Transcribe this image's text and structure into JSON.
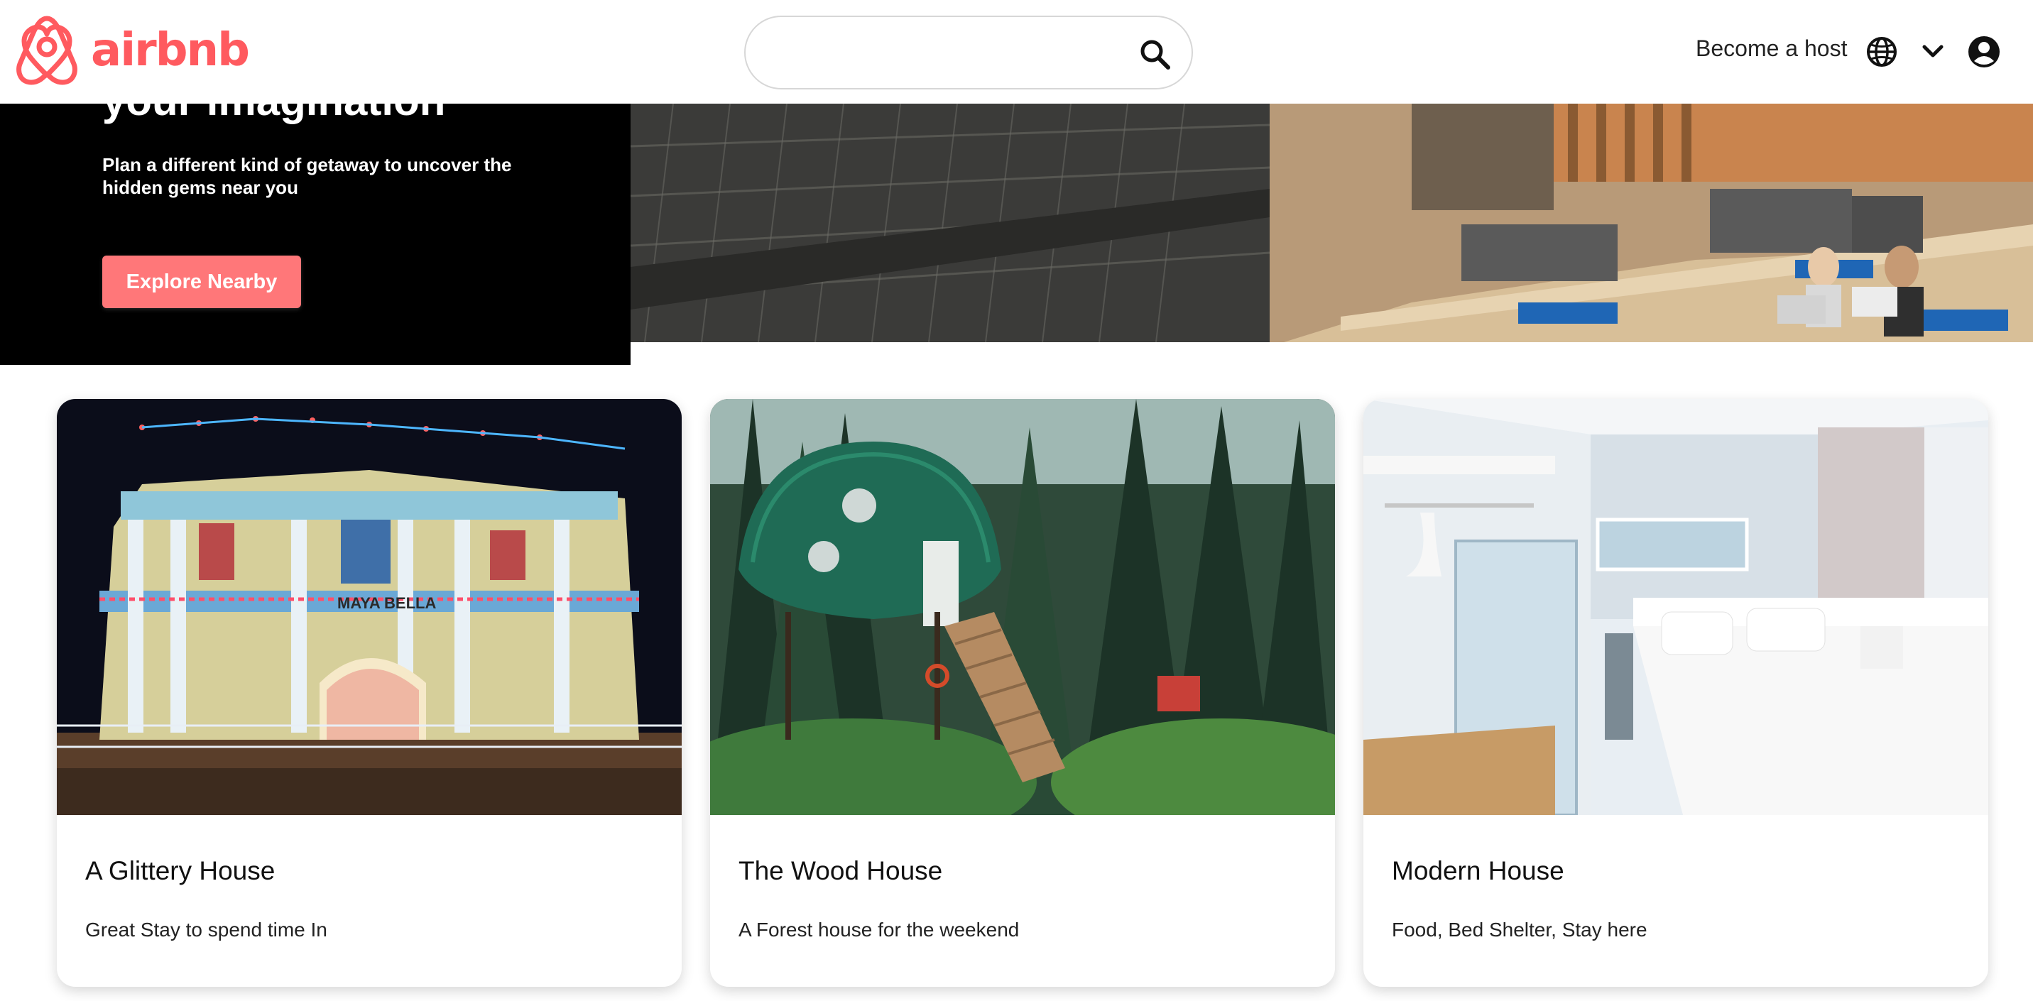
{
  "brand": {
    "name": "airbnb",
    "color": "#ff5a5f"
  },
  "header": {
    "search": {
      "value": "",
      "placeholder": ""
    },
    "host_link": "Become a host",
    "icons": [
      "globe-icon",
      "chevron-down-icon",
      "user-circle-icon",
      "search-icon"
    ]
  },
  "hero": {
    "title": "your imagination",
    "subtitle": "Plan a different kind of getaway to uncover the hidden gems near you",
    "button_label": "Explore Nearby",
    "accent": "#ff7779"
  },
  "cards": [
    {
      "title": "A Glittery House",
      "description": "Great Stay to spend time In"
    },
    {
      "title": "The Wood House",
      "description": "A Forest house for the weekend"
    },
    {
      "title": "Modern House",
      "description": "Food, Bed Shelter, Stay here"
    }
  ],
  "photo_labels": {
    "house_sign": "MAYA BELLA"
  }
}
